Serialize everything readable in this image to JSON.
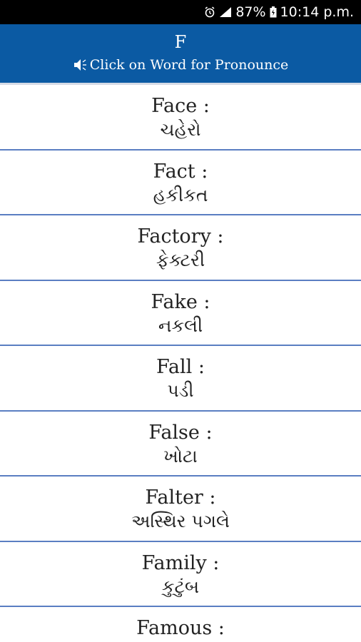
{
  "status_bar": {
    "battery": "87%",
    "time": "10:14 p.m."
  },
  "header": {
    "letter": "F",
    "hint": "Click on Word for Pronounce"
  },
  "words": [
    {
      "english": "Face :",
      "gujarati": "ચહેરો"
    },
    {
      "english": "Fact :",
      "gujarati": "હકીકત"
    },
    {
      "english": "Factory :",
      "gujarati": "ફેક્ટરી"
    },
    {
      "english": "Fake :",
      "gujarati": "નકલી"
    },
    {
      "english": "Fall :",
      "gujarati": "પડી"
    },
    {
      "english": "False :",
      "gujarati": "ખોટા"
    },
    {
      "english": "Falter :",
      "gujarati": "અસ્થિર પગલે"
    },
    {
      "english": "Family :",
      "gujarati": "કુટુંબ"
    },
    {
      "english": "Famous :",
      "gujarati": ""
    }
  ],
  "colors": {
    "header_bg": "#0b5aa3",
    "divider": "#5a7ec2"
  },
  "icons": [
    "alarm-icon",
    "signal-icon",
    "battery-icon",
    "speaker-icon"
  ]
}
